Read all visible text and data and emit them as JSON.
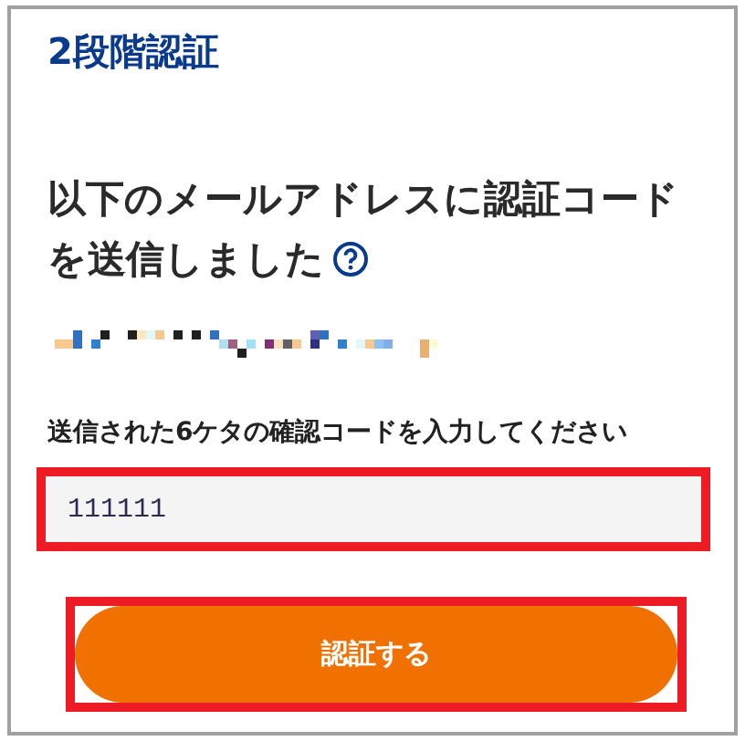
{
  "title": "2段階認証",
  "message": "以下のメールアドレスに認証コードを送信しました",
  "code_field": {
    "label": "送信された6ケタの確認コードを入力してください",
    "value": "111111",
    "highlighted": true
  },
  "submit_button": {
    "label": "認証する",
    "highlighted": true
  }
}
